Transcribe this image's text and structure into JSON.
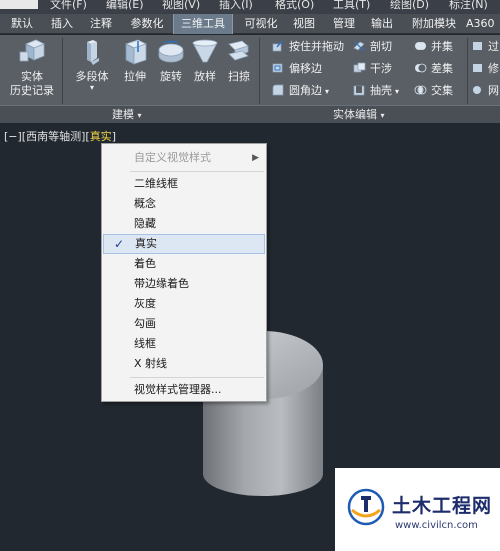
{
  "menubar": {
    "items": [
      "文件(F)",
      "编辑(E)",
      "视图(V)",
      "插入(I)",
      "格式(O)",
      "工具(T)",
      "绘图(D)",
      "标注(N)"
    ]
  },
  "tabs": [
    {
      "label": "默认",
      "active": false
    },
    {
      "label": "插入",
      "active": false
    },
    {
      "label": "注释",
      "active": false
    },
    {
      "label": "参数化",
      "active": false
    },
    {
      "label": "三维工具",
      "active": true
    },
    {
      "label": "可视化",
      "active": false
    },
    {
      "label": "视图",
      "active": false
    },
    {
      "label": "管理",
      "active": false
    },
    {
      "label": "输出",
      "active": false
    },
    {
      "label": "附加模块",
      "active": false
    },
    {
      "label": "A360",
      "active": false
    }
  ],
  "ribbon": {
    "history": {
      "line1": "实体",
      "line2": "历史记录"
    },
    "modeling_buttons": [
      {
        "label": "多段体",
        "icon": "polysolid-icon"
      },
      {
        "label": "拉伸",
        "icon": "extrude-icon"
      },
      {
        "label": "旋转",
        "icon": "revolve-icon"
      },
      {
        "label": "放样",
        "icon": "loft-icon"
      },
      {
        "label": "扫掠",
        "icon": "sweep-icon"
      }
    ],
    "solid_edit_buttons": [
      {
        "label": "按住并拖动",
        "icon": "presspull-icon"
      },
      {
        "label": "剖切",
        "icon": "slice-icon"
      },
      {
        "label": "并集",
        "icon": "union-icon"
      },
      {
        "label": "偏移边",
        "icon": "offset-edge-icon"
      },
      {
        "label": "干涉",
        "icon": "interfere-icon"
      },
      {
        "label": "差集",
        "icon": "subtract-icon"
      },
      {
        "label": "圆角边",
        "icon": "fillet-edge-icon"
      },
      {
        "label": "抽壳",
        "icon": "shell-icon"
      },
      {
        "label": "交集",
        "icon": "intersect-icon"
      }
    ],
    "partial_buttons": [
      "过",
      "修",
      "网"
    ],
    "panel_titles": {
      "modeling": "建模",
      "solid_edit": "实体编辑"
    }
  },
  "viewport": {
    "label_prefix": "[−][西南等轴测][",
    "visual_style": "真实",
    "label_suffix": "]"
  },
  "context_menu": {
    "header": "自定义视觉样式",
    "items": [
      {
        "label": "二维线框",
        "checked": false
      },
      {
        "label": "概念",
        "checked": false
      },
      {
        "label": "隐藏",
        "checked": false
      },
      {
        "label": "真实",
        "checked": true
      },
      {
        "label": "着色",
        "checked": false
      },
      {
        "label": "带边缘着色",
        "checked": false
      },
      {
        "label": "灰度",
        "checked": false
      },
      {
        "label": "勾画",
        "checked": false
      },
      {
        "label": "线框",
        "checked": false
      },
      {
        "label": "X 射线",
        "checked": false
      }
    ],
    "manager": "视觉样式管理器...",
    "check_glyph": "✓"
  },
  "watermark": {
    "title": "土木工程网",
    "url": "www.civilcn.com"
  }
}
